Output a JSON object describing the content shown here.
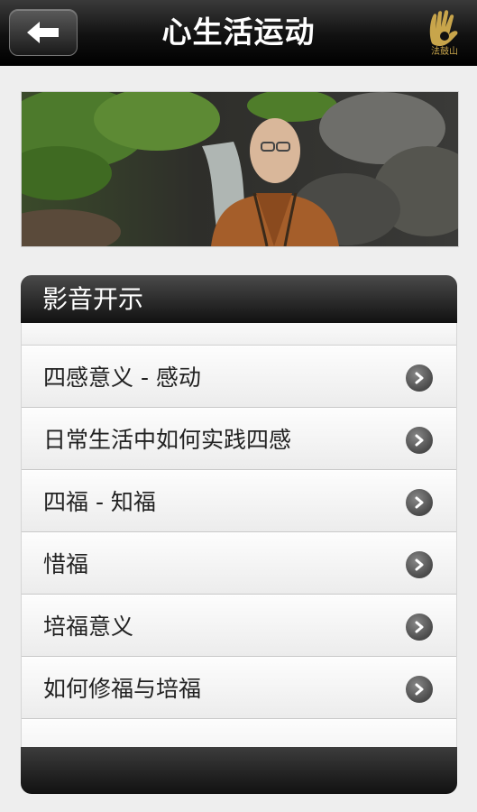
{
  "header": {
    "title": "心生活运动",
    "logo_text": "法鼓山"
  },
  "section": {
    "title": "影音开示"
  },
  "items": [
    {
      "label": "四感意义 - 感动"
    },
    {
      "label": "日常生活中如何实践四感"
    },
    {
      "label": "四福 - 知福"
    },
    {
      "label": "惜福"
    },
    {
      "label": "培福意义"
    },
    {
      "label": "如何修福与培福"
    }
  ],
  "icons": {
    "back": "back-arrow-icon",
    "item": "chevron-right-circle-icon"
  },
  "colors": {
    "bar_dark": "#111111",
    "accent_gold": "#c8a54b"
  }
}
